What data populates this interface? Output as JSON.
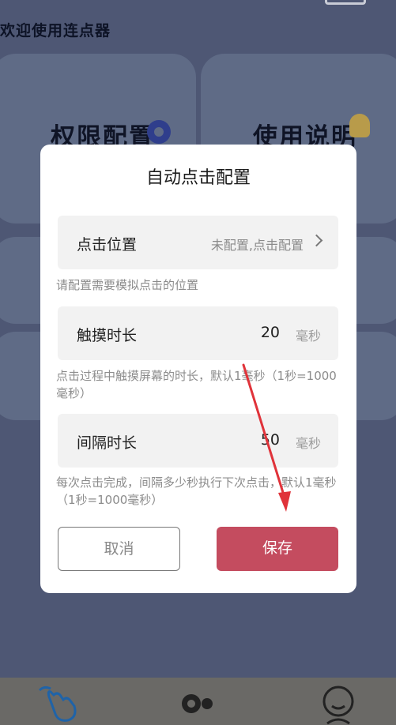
{
  "background": {
    "welcome_text": "欢迎使用连点器",
    "cards": [
      {
        "label": "权限配置"
      },
      {
        "label": "使用说明"
      }
    ]
  },
  "dialog": {
    "title": "自动点击配置",
    "click_position": {
      "label": "点击位置",
      "value": "未配置,点击配置",
      "hint": "请配置需要模拟点击的位置"
    },
    "touch_duration": {
      "label": "触摸时长",
      "value": "20",
      "unit": "毫秒",
      "hint": "点击过程中触摸屏幕的时长，默认1毫秒（1秒=1000毫秒）"
    },
    "interval_duration": {
      "label": "间隔时长",
      "value": "50",
      "unit": "毫秒",
      "hint": "每次点击完成，间隔多少秒执行下次点击，默认1毫秒（1秒=1000毫秒）"
    },
    "cancel_label": "取消",
    "save_label": "保存"
  },
  "colors": {
    "save_button": "#c44c5f",
    "arrow": "#e0333a"
  },
  "bottom_nav": {
    "icons": [
      "tap-hand-icon",
      "key-icon",
      "user-icon"
    ]
  }
}
